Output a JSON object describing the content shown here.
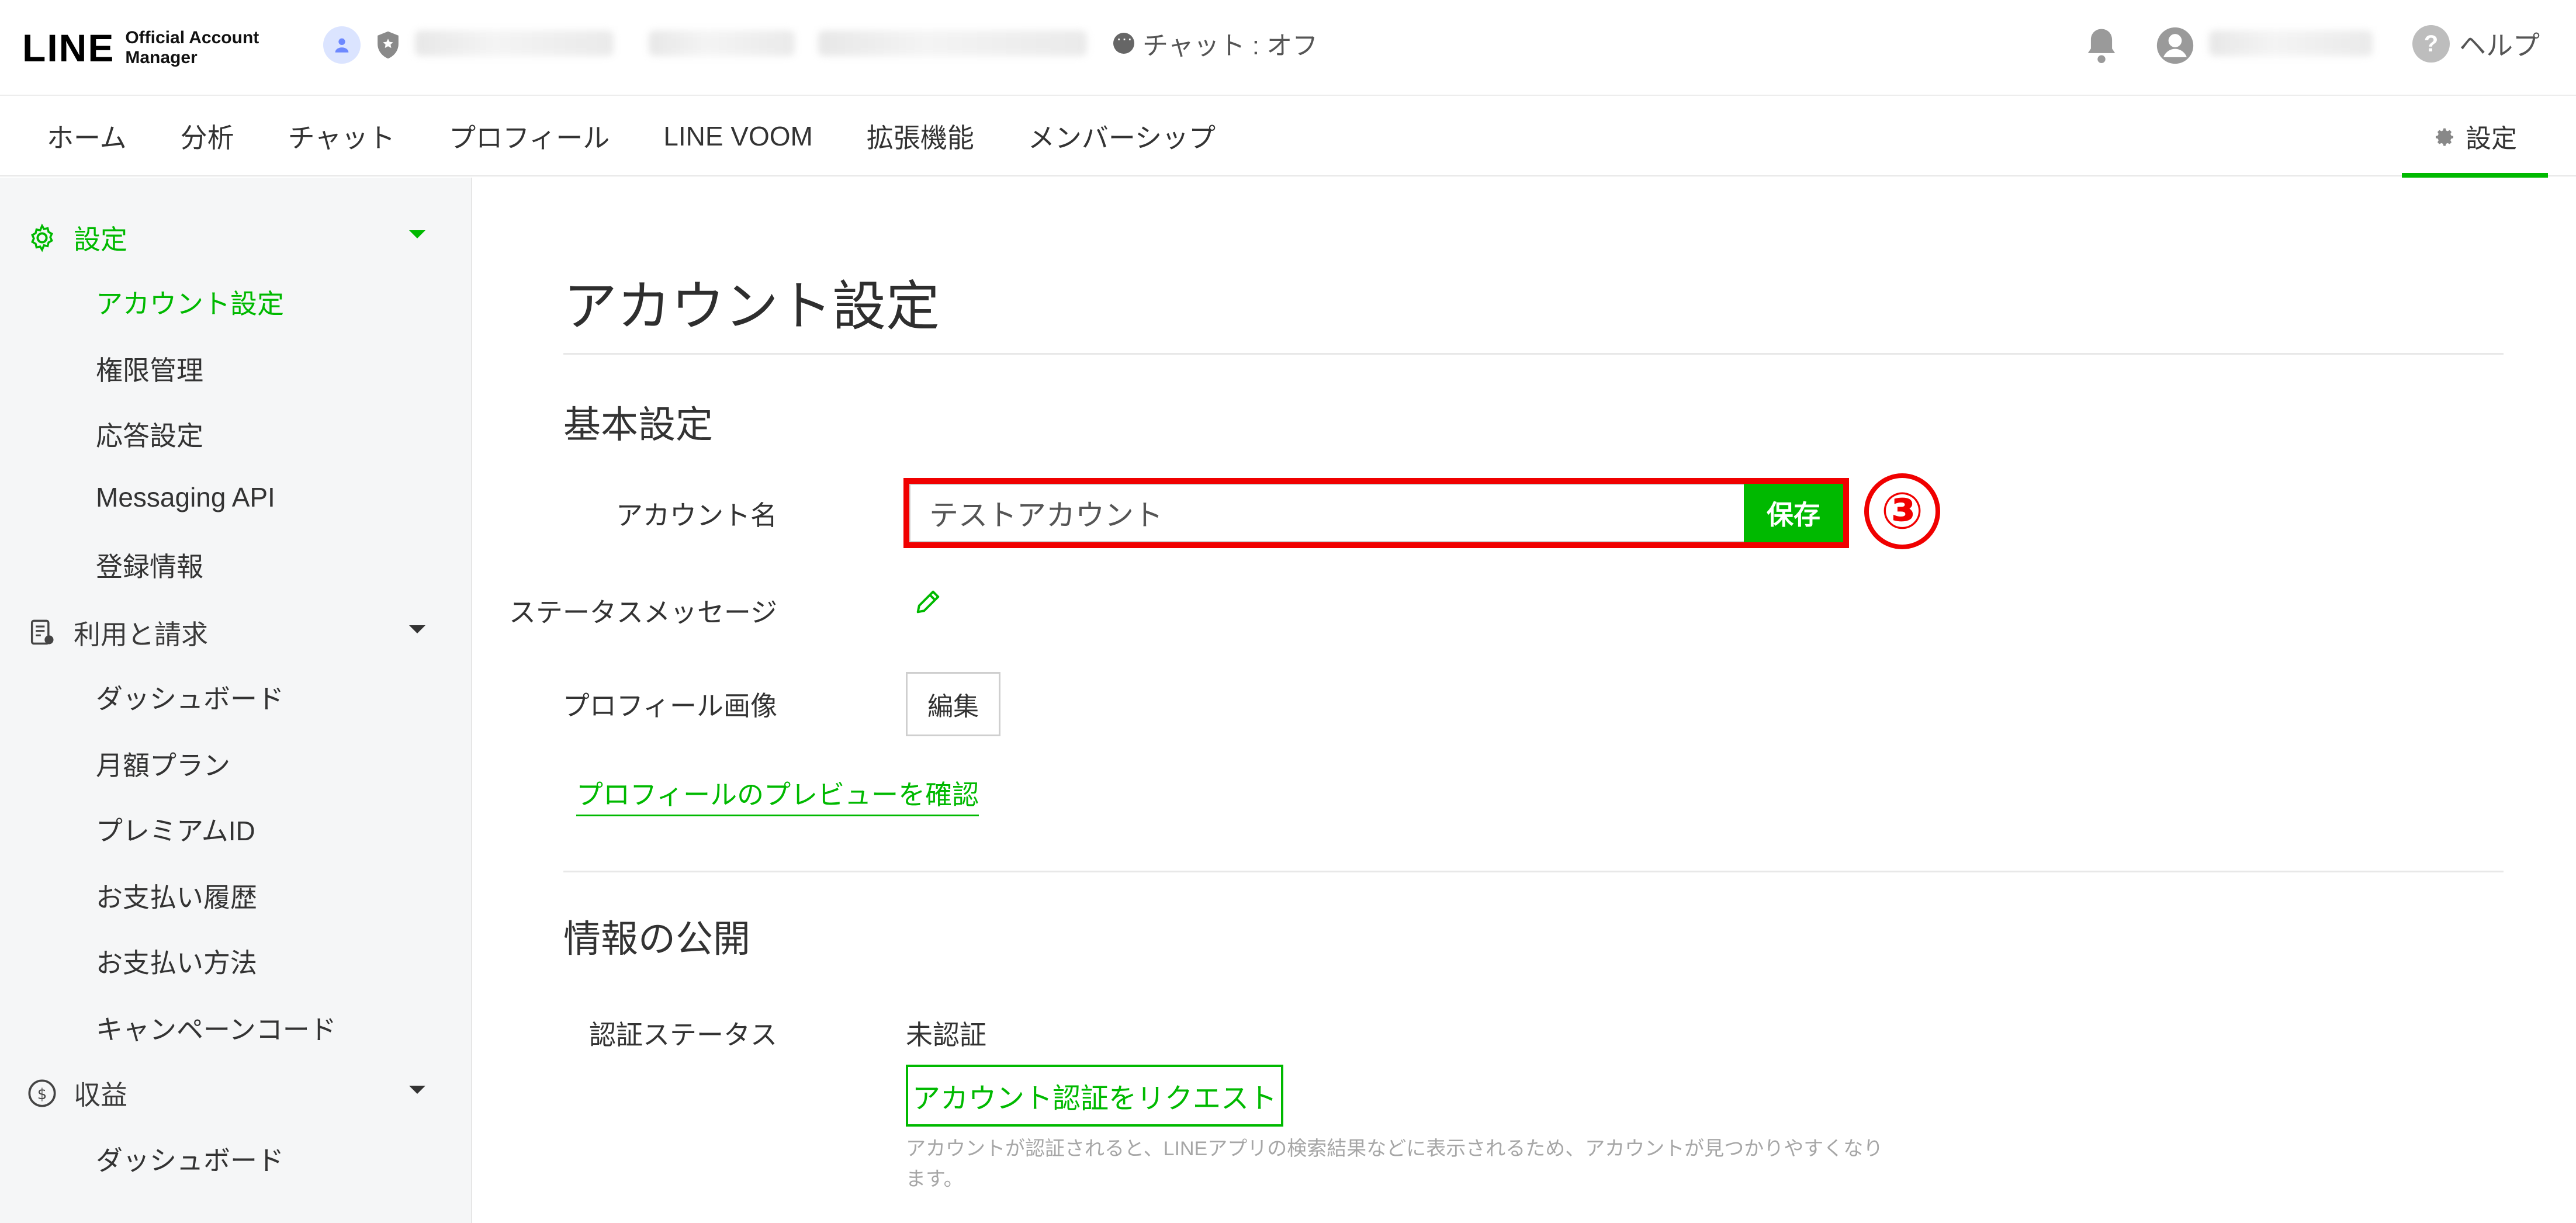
{
  "header": {
    "logo_main": "LINE",
    "logo_sub_line1": "Official Account",
    "logo_sub_line2": "Manager",
    "chat_status": "チャット : オフ",
    "help_label": "ヘルプ",
    "help_glyph": "?"
  },
  "nav": {
    "items": [
      "ホーム",
      "分析",
      "チャット",
      "プロフィール",
      "LINE VOOM",
      "拡張機能",
      "メンバーシップ"
    ],
    "settings_label": "設定"
  },
  "sidebar": {
    "settings_section": "設定",
    "settings_items": [
      "アカウント設定",
      "権限管理",
      "応答設定",
      "Messaging API",
      "登録情報"
    ],
    "billing_section": "利用と請求",
    "billing_items": [
      "ダッシュボード",
      "月額プラン",
      "プレミアムID",
      "お支払い履歴",
      "お支払い方法",
      "キャンペーンコード"
    ],
    "revenue_section": "収益",
    "revenue_items": [
      "ダッシュボード"
    ]
  },
  "main": {
    "title": "アカウント設定",
    "basic_section": "基本設定",
    "account_name_label": "アカウント名",
    "account_name_value": "テストアカウント",
    "save_label": "保存",
    "callout_number": "③",
    "status_message_label": "ステータスメッセージ",
    "profile_image_label": "プロフィール画像",
    "edit_label": "編集",
    "preview_link": "プロフィールのプレビューを確認",
    "public_section": "情報の公開",
    "verification_label": "認証ステータス",
    "verification_value": "未認証",
    "request_button": "アカウント認証をリクエスト",
    "help_text": "アカウントが認証されると、LINEアプリの検索結果などに表示されるため、アカウントが見つかりやすくなります。"
  },
  "colors": {
    "accent": "#00b900",
    "highlight": "#f00000"
  }
}
